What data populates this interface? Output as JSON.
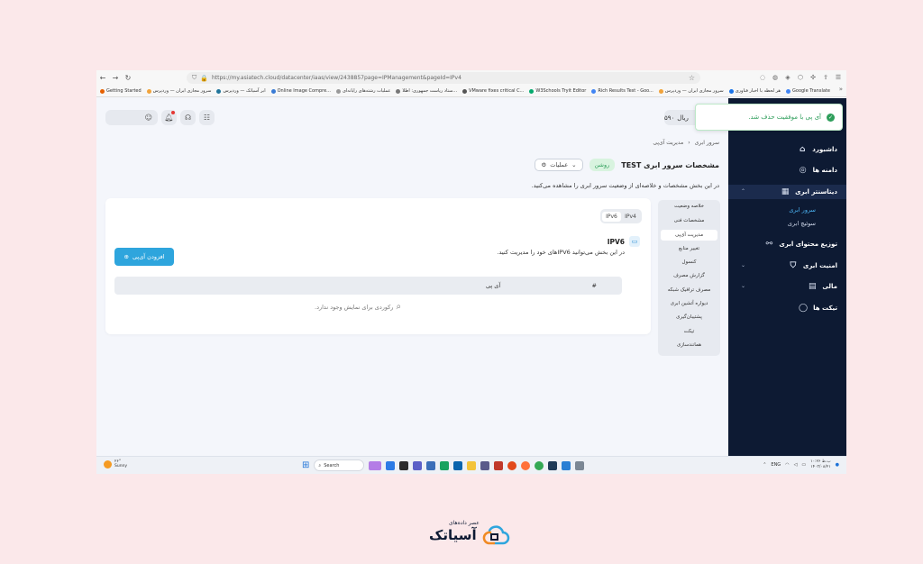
{
  "browser": {
    "url": "https://my.asiatech.cloud/datacenter/iaas/view/2438857page=IPManagement&pageId=IPv4",
    "bookmarks": [
      "Getting Started",
      "سرور مجازی ایران — وردپرس",
      "ابر آسیاتک — وردپرس",
      "Online Image Compre...",
      "عملیات رشته‌های رایانه‌ای",
      "ستاد ریاست جمهوری: اطلا...",
      "VMware fixes critical C...",
      "W3Schools Tryit Editor",
      "Rich Results Test - Goo...",
      "سرور مجازی ایران — وردپرس",
      "هر لحظه با اخبار فناوری",
      "Google Translate"
    ]
  },
  "toast": {
    "message": "آی پی با موفقیت حذف شد."
  },
  "topbar": {
    "balance_amount": "۵۹۰",
    "balance_unit": "ریال"
  },
  "sidebar": {
    "items": [
      {
        "label": "داشبورد",
        "icon": "home-icon"
      },
      {
        "label": "دامنه ها",
        "icon": "globe-icon"
      },
      {
        "label": "دیتاسنتر ابری",
        "icon": "server-icon"
      },
      {
        "label": "توزیع محتوای ابری",
        "icon": "share-icon"
      },
      {
        "label": "امنیت ابری",
        "icon": "shield-icon"
      },
      {
        "label": "مالی",
        "icon": "wallet-icon"
      },
      {
        "label": "تیکت ها",
        "icon": "chat-icon"
      }
    ],
    "subitems": [
      "سرور ابری",
      "سوئیچ ابری"
    ]
  },
  "breadcrumb": [
    "سرور ابری",
    "مدیریت آی‌پی"
  ],
  "page": {
    "title": "مشخصات سرور ابری TEST",
    "status": "روشن",
    "ops_label": "عملیات",
    "description": "در این بخش مشخصات و خلاصه‌ای از وضعیت سرور ابری را مشاهده می‌کنید."
  },
  "tabs": [
    "خلاصه وضعیت",
    "مشخصات فنی",
    "مدیریت آی‌پی",
    "تغییر منابع",
    "کنسول",
    "گزارش مصرف",
    "مصرف ترافیک شبکه",
    "دیواره آتشین ابری",
    "پشتیبان‌گیری",
    "تیکت",
    "همانندسازی"
  ],
  "ip_panel": {
    "toggle": [
      "IPv6",
      "IPv4"
    ],
    "section_title": "IPV6",
    "section_desc": "در این بخش می‌توانید IPV6های خود را مدیریت کنید.",
    "add_button": "افزودن آی‌پی",
    "columns": [
      "#",
      "آی پی"
    ],
    "empty_text": "رکوردی برای نمایش وجود ندارد."
  },
  "taskbar": {
    "weather_temp": "۲۶°",
    "weather_desc": "Sunny",
    "search_label": "Search",
    "lang": "ENG",
    "time": "۱۰:۲۶ ب.ظ",
    "date": "۱۴۰۳/۰۸/۲۱"
  },
  "brand": {
    "tagline": "عصر داده‌های",
    "name": "آسیاتک"
  },
  "colors": {
    "sidebar_bg": "#0d1a33",
    "accent": "#2ea5dd",
    "success": "#2e9e5b"
  }
}
